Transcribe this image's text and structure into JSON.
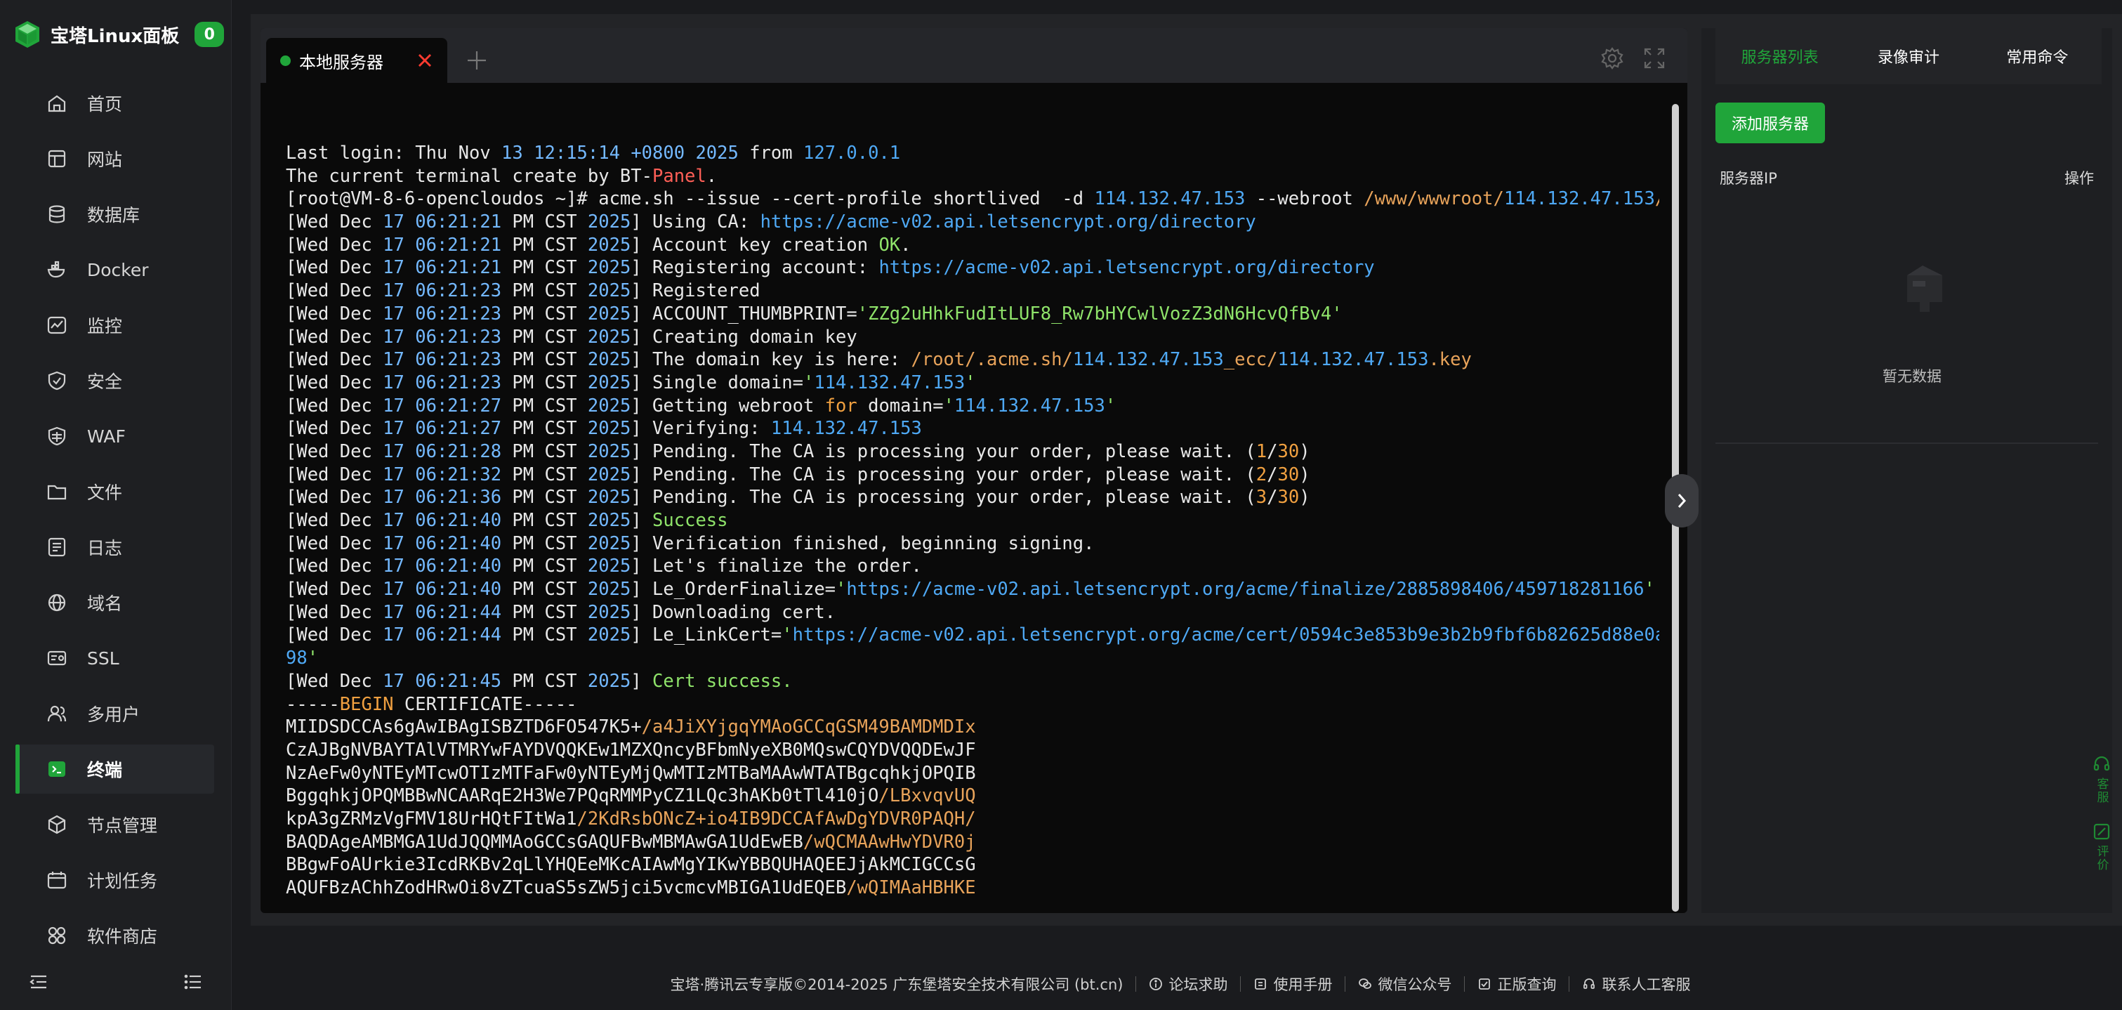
{
  "brand": {
    "title": "宝塔Linux面板",
    "badge": "0"
  },
  "nav": [
    {
      "label": "首页",
      "icon": "home-icon"
    },
    {
      "label": "网站",
      "icon": "website-icon"
    },
    {
      "label": "数据库",
      "icon": "database-icon"
    },
    {
      "label": "Docker",
      "icon": "docker-icon"
    },
    {
      "label": "监控",
      "icon": "monitor-icon"
    },
    {
      "label": "安全",
      "icon": "shield-icon"
    },
    {
      "label": "WAF",
      "icon": "waf-icon"
    },
    {
      "label": "文件",
      "icon": "folder-icon"
    },
    {
      "label": "日志",
      "icon": "log-icon"
    },
    {
      "label": "域名",
      "icon": "globe-icon"
    },
    {
      "label": "SSL",
      "icon": "ssl-icon"
    },
    {
      "label": "多用户",
      "icon": "users-icon"
    },
    {
      "label": "终端",
      "icon": "terminal-icon",
      "active": true
    },
    {
      "label": "节点管理",
      "icon": "cube-icon"
    },
    {
      "label": "计划任务",
      "icon": "calendar-icon"
    },
    {
      "label": "软件商店",
      "icon": "apps-icon"
    }
  ],
  "terminal": {
    "tab_label": "本地服务器",
    "lines": [
      [
        [
          "Last login: Thu Nov ",
          ""
        ],
        [
          "13",
          "c-num"
        ],
        [
          " ",
          ""
        ],
        [
          "12:15:14",
          "c-num"
        ],
        [
          " ",
          ""
        ],
        [
          "+0800",
          "c-num"
        ],
        [
          " ",
          ""
        ],
        [
          "2025",
          "c-num"
        ],
        [
          " from ",
          ""
        ],
        [
          "127.0.0.1",
          "c-url"
        ]
      ],
      [
        [
          "The current terminal create by BT-",
          ""
        ],
        [
          "Panel",
          "c-red"
        ],
        [
          ".",
          ""
        ]
      ],
      [
        [
          "[root@VM-8-6-opencloudos ~]# acme.sh --issue --cert-profile shortlived  -d ",
          ""
        ],
        [
          "114.132.47.153",
          "c-url"
        ],
        [
          " --webroot ",
          ""
        ],
        [
          "/www/wwwroot/",
          "c-path"
        ],
        [
          "114.132.47.153",
          "c-url"
        ],
        [
          "/",
          "c-path"
        ]
      ],
      [
        [
          "[Wed Dec ",
          ""
        ],
        [
          "17",
          "c-num"
        ],
        [
          " ",
          ""
        ],
        [
          "06:21:21",
          "c-num"
        ],
        [
          " PM CST ",
          ""
        ],
        [
          "2025",
          "c-num"
        ],
        [
          "] Using CA: ",
          ""
        ],
        [
          "https://acme-v02.api.letsencrypt.org/directory",
          "c-url"
        ]
      ],
      [
        [
          "[Wed Dec ",
          ""
        ],
        [
          "17",
          "c-num"
        ],
        [
          " ",
          ""
        ],
        [
          "06:21:21",
          "c-num"
        ],
        [
          " PM CST ",
          ""
        ],
        [
          "2025",
          "c-num"
        ],
        [
          "] Account key creation ",
          ""
        ],
        [
          "OK",
          "c-green"
        ],
        [
          ".",
          ""
        ]
      ],
      [
        [
          "[Wed Dec ",
          ""
        ],
        [
          "17",
          "c-num"
        ],
        [
          " ",
          ""
        ],
        [
          "06:21:21",
          "c-num"
        ],
        [
          " PM CST ",
          ""
        ],
        [
          "2025",
          "c-num"
        ],
        [
          "] Registering account: ",
          ""
        ],
        [
          "https://acme-v02.api.letsencrypt.org/directory",
          "c-url"
        ]
      ],
      [
        [
          "[Wed Dec ",
          ""
        ],
        [
          "17",
          "c-num"
        ],
        [
          " ",
          ""
        ],
        [
          "06:21:23",
          "c-num"
        ],
        [
          " PM CST ",
          ""
        ],
        [
          "2025",
          "c-num"
        ],
        [
          "] Registered",
          ""
        ]
      ],
      [
        [
          "[Wed Dec ",
          ""
        ],
        [
          "17",
          "c-num"
        ],
        [
          " ",
          ""
        ],
        [
          "06:21:23",
          "c-num"
        ],
        [
          " PM CST ",
          ""
        ],
        [
          "2025",
          "c-num"
        ],
        [
          "] ACCOUNT_THUMBPRINT=",
          ""
        ],
        [
          "'ZZg2uHhkFudItLUF8_Rw7bHYCwlVozZ3dN6HcvQfBv4'",
          "c-green"
        ]
      ],
      [
        [
          "[Wed Dec ",
          ""
        ],
        [
          "17",
          "c-num"
        ],
        [
          " ",
          ""
        ],
        [
          "06:21:23",
          "c-num"
        ],
        [
          " PM CST ",
          ""
        ],
        [
          "2025",
          "c-num"
        ],
        [
          "] Creating domain key",
          ""
        ]
      ],
      [
        [
          "[Wed Dec ",
          ""
        ],
        [
          "17",
          "c-num"
        ],
        [
          " ",
          ""
        ],
        [
          "06:21:23",
          "c-num"
        ],
        [
          " PM CST ",
          ""
        ],
        [
          "2025",
          "c-num"
        ],
        [
          "] The domain key is here: ",
          ""
        ],
        [
          "/root/.acme.sh/",
          "c-path"
        ],
        [
          "114.132.47.153",
          "c-url"
        ],
        [
          "_ecc/",
          "c-path"
        ],
        [
          "114.132.47.153",
          "c-url"
        ],
        [
          ".key",
          "c-path"
        ]
      ],
      [
        [
          "[Wed Dec ",
          ""
        ],
        [
          "17",
          "c-num"
        ],
        [
          " ",
          ""
        ],
        [
          "06:21:23",
          "c-num"
        ],
        [
          " PM CST ",
          ""
        ],
        [
          "2025",
          "c-num"
        ],
        [
          "] Single domain=",
          ""
        ],
        [
          "'",
          "c-green"
        ],
        [
          "114.132.47.153",
          "c-url"
        ],
        [
          "'",
          "c-green"
        ]
      ],
      [
        [
          "[Wed Dec ",
          ""
        ],
        [
          "17",
          "c-num"
        ],
        [
          " ",
          ""
        ],
        [
          "06:21:27",
          "c-num"
        ],
        [
          " PM CST ",
          ""
        ],
        [
          "2025",
          "c-num"
        ],
        [
          "] Getting webroot ",
          ""
        ],
        [
          "for",
          "c-orange"
        ],
        [
          " domain=",
          ""
        ],
        [
          "'",
          "c-green"
        ],
        [
          "114.132.47.153",
          "c-url"
        ],
        [
          "'",
          "c-green"
        ]
      ],
      [
        [
          "[Wed Dec ",
          ""
        ],
        [
          "17",
          "c-num"
        ],
        [
          " ",
          ""
        ],
        [
          "06:21:27",
          "c-num"
        ],
        [
          " PM CST ",
          ""
        ],
        [
          "2025",
          "c-num"
        ],
        [
          "] Verifying: ",
          ""
        ],
        [
          "114.132.47.153",
          "c-url"
        ]
      ],
      [
        [
          "[Wed Dec ",
          ""
        ],
        [
          "17",
          "c-num"
        ],
        [
          " ",
          ""
        ],
        [
          "06:21:28",
          "c-num"
        ],
        [
          " PM CST ",
          ""
        ],
        [
          "2025",
          "c-num"
        ],
        [
          "] Pending. The CA is processing your order, please wait. (",
          ""
        ],
        [
          "1",
          "c-orange"
        ],
        [
          "/",
          ""
        ],
        [
          "30",
          "c-orange"
        ],
        [
          ")",
          ""
        ]
      ],
      [
        [
          "[Wed Dec ",
          ""
        ],
        [
          "17",
          "c-num"
        ],
        [
          " ",
          ""
        ],
        [
          "06:21:32",
          "c-num"
        ],
        [
          " PM CST ",
          ""
        ],
        [
          "2025",
          "c-num"
        ],
        [
          "] Pending. The CA is processing your order, please wait. (",
          ""
        ],
        [
          "2",
          "c-orange"
        ],
        [
          "/",
          ""
        ],
        [
          "30",
          "c-orange"
        ],
        [
          ")",
          ""
        ]
      ],
      [
        [
          "[Wed Dec ",
          ""
        ],
        [
          "17",
          "c-num"
        ],
        [
          " ",
          ""
        ],
        [
          "06:21:36",
          "c-num"
        ],
        [
          " PM CST ",
          ""
        ],
        [
          "2025",
          "c-num"
        ],
        [
          "] Pending. The CA is processing your order, please wait. (",
          ""
        ],
        [
          "3",
          "c-orange"
        ],
        [
          "/",
          ""
        ],
        [
          "30",
          "c-orange"
        ],
        [
          ")",
          ""
        ]
      ],
      [
        [
          "[Wed Dec ",
          ""
        ],
        [
          "17",
          "c-num"
        ],
        [
          " ",
          ""
        ],
        [
          "06:21:40",
          "c-num"
        ],
        [
          " PM CST ",
          ""
        ],
        [
          "2025",
          "c-num"
        ],
        [
          "] ",
          ""
        ],
        [
          "Success",
          "c-green"
        ]
      ],
      [
        [
          "[Wed Dec ",
          ""
        ],
        [
          "17",
          "c-num"
        ],
        [
          " ",
          ""
        ],
        [
          "06:21:40",
          "c-num"
        ],
        [
          " PM CST ",
          ""
        ],
        [
          "2025",
          "c-num"
        ],
        [
          "] Verification finished, beginning signing.",
          ""
        ]
      ],
      [
        [
          "[Wed Dec ",
          ""
        ],
        [
          "17",
          "c-num"
        ],
        [
          " ",
          ""
        ],
        [
          "06:21:40",
          "c-num"
        ],
        [
          " PM CST ",
          ""
        ],
        [
          "2025",
          "c-num"
        ],
        [
          "] Let's finalize the order.",
          ""
        ]
      ],
      [
        [
          "[Wed Dec ",
          ""
        ],
        [
          "17",
          "c-num"
        ],
        [
          " ",
          ""
        ],
        [
          "06:21:40",
          "c-num"
        ],
        [
          " PM CST ",
          ""
        ],
        [
          "2025",
          "c-num"
        ],
        [
          "] Le_OrderFinalize=",
          ""
        ],
        [
          "'",
          "c-green"
        ],
        [
          "https://acme-v02.api.letsencrypt.org/acme/finalize/2885898406/459718281166",
          "c-url"
        ],
        [
          "'",
          "c-green"
        ]
      ],
      [
        [
          "[Wed Dec ",
          ""
        ],
        [
          "17",
          "c-num"
        ],
        [
          " ",
          ""
        ],
        [
          "06:21:44",
          "c-num"
        ],
        [
          " PM CST ",
          ""
        ],
        [
          "2025",
          "c-num"
        ],
        [
          "] Downloading cert.",
          ""
        ]
      ],
      [
        [
          "[Wed Dec ",
          ""
        ],
        [
          "17",
          "c-num"
        ],
        [
          " ",
          ""
        ],
        [
          "06:21:44",
          "c-num"
        ],
        [
          " PM CST ",
          ""
        ],
        [
          "2025",
          "c-num"
        ],
        [
          "] Le_LinkCert=",
          ""
        ],
        [
          "'",
          "c-green"
        ],
        [
          "https://acme-v02.api.letsencrypt.org/acme/cert/0594c3e853b9e3b2b9fbf6b82625d88e0a",
          "c-url"
        ]
      ],
      [
        [
          "98",
          "c-url"
        ],
        [
          "'",
          "c-green"
        ]
      ],
      [
        [
          "[Wed Dec ",
          ""
        ],
        [
          "17",
          "c-num"
        ],
        [
          " ",
          ""
        ],
        [
          "06:21:45",
          "c-num"
        ],
        [
          " PM CST ",
          ""
        ],
        [
          "2025",
          "c-num"
        ],
        [
          "] ",
          ""
        ],
        [
          "Cert success.",
          "c-green"
        ]
      ],
      [
        [
          "-----",
          ""
        ],
        [
          "BEGIN",
          "c-orange"
        ],
        [
          " CERTIFICATE-----",
          ""
        ]
      ],
      [
        [
          "MIIDSDCCAs6gAwIBAgISBZTD6FO547K5+",
          ""
        ],
        [
          "/a4JiXYjgqYMAoGCCqGSM49BAMDMDIx",
          "c-path"
        ]
      ],
      [
        [
          "CzAJBgNVBAYTAlVTMRYwFAYDVQQKEw1MZXQncyBFbmNyeXB0MQswCQYDVQQDEwJF",
          ""
        ]
      ],
      [
        [
          "NzAeFw0yNTEyMTcwOTIzMTFaFw0yNTEyMjQwMTIzMTBaMAAwWTATBgcqhkjOPQIB",
          ""
        ]
      ],
      [
        [
          "BggqhkjOPQMBBwNCAARqE2H3We7PQqRMMPyCZ1LQc3hAKb0tTl410jO",
          ""
        ],
        [
          "/LBxvqvUQ",
          "c-path"
        ]
      ],
      [
        [
          "kpA3gZRMzVgFMV18UrHQtFItWa1",
          ""
        ],
        [
          "/2KdRsbONcZ+io4IB9DCCAfAwDgYDVR0PAQH/",
          "c-path"
        ]
      ],
      [
        [
          "BAQDAgeAMBMGA1UdJQQMMAoGCCsGAQUFBwMBMAwGA1UdEwEB",
          ""
        ],
        [
          "/wQCMAAwHwYDVR0j",
          "c-path"
        ]
      ],
      [
        [
          "BBgwFoAUrkie3IcdRKBv2qLlYHQEeMKcAIAwMgYIKwYBBQUHAQEEJjAkMCIGCCsG",
          ""
        ]
      ],
      [
        [
          "AQUFBzAChhZodHRwOi8vZTcuaS5sZW5jci5vcmcvMBIGA1UdEQEB",
          ""
        ],
        [
          "/wQIMAaHBHKE",
          "c-path"
        ]
      ]
    ]
  },
  "right_panel": {
    "tabs": [
      "服务器列表",
      "录像审计",
      "常用命令"
    ],
    "add_server": "添加服务器",
    "col_ip": "服务器IP",
    "col_action": "操作",
    "empty": "暂无数据"
  },
  "float_tools": {
    "service": "客服",
    "review": "评价"
  },
  "footer": {
    "copyright": "宝塔·腾讯云专享版©2014-2025 广东堡塔安全技术有限公司 (bt.cn)",
    "forum": "论坛求助",
    "manual": "使用手册",
    "wechat": "微信公众号",
    "verify": "正版查询",
    "support": "联系人工客服"
  },
  "colors": {
    "accent": "#20a53a",
    "bg": "#1a1b1e",
    "terminal_bg": "#0a0a0a"
  }
}
